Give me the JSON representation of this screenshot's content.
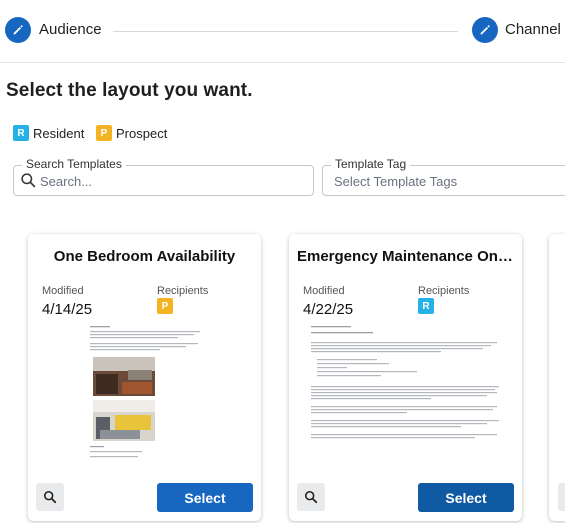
{
  "stepper": {
    "steps": [
      {
        "label": "Audience",
        "icon": "pencil-icon"
      },
      {
        "label": "Channel",
        "icon": "pencil-icon"
      }
    ]
  },
  "heading": "Select the layout you want.",
  "legend": [
    {
      "letter": "R",
      "label": "Resident",
      "color": "#26b1e6"
    },
    {
      "letter": "P",
      "label": "Prospect",
      "color": "#f4b322"
    }
  ],
  "search": {
    "label": "Search Templates",
    "placeholder": "Search...",
    "icon": "search-icon"
  },
  "tag_filter": {
    "label": "Template Tag",
    "placeholder": "Select Template Tags"
  },
  "cards": [
    {
      "title": "One Bedroom Availability",
      "modified_label": "Modified",
      "modified_date": "4/14/25",
      "recipients_label": "Recipients",
      "recipient_badge": "P",
      "badge_color": "#f4b322",
      "select_label": "Select",
      "select_color": "#1767c0"
    },
    {
      "title": "Emergency Maintenance On ...",
      "modified_label": "Modified",
      "modified_date": "4/22/25",
      "recipients_label": "Recipients",
      "recipient_badge": "R",
      "badge_color": "#26b1e6",
      "select_label": "Select",
      "select_color": "#0f5aa3"
    }
  ],
  "colors": {
    "accent": "#1767c0"
  }
}
